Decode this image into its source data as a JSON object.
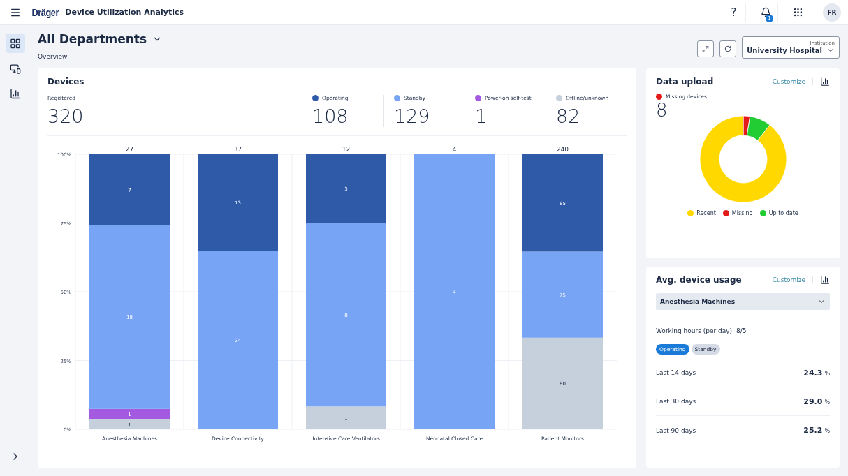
{
  "app": {
    "logo": "Dräger",
    "title": "Device Utilization Analytics"
  },
  "topbar": {
    "help": "?",
    "notification_count": "1",
    "avatar": "FR"
  },
  "sidebar": {
    "items": [
      {
        "kind": "grid",
        "selected": true
      },
      {
        "kind": "devices",
        "selected": false
      },
      {
        "kind": "chart",
        "selected": false
      }
    ]
  },
  "page": {
    "title": "All Departments",
    "subtitle": "Overview",
    "institution": {
      "label": "Institution",
      "value": "University Hospital"
    }
  },
  "devices": {
    "title": "Devices",
    "registered": {
      "label": "Registered",
      "value": "320"
    },
    "stats": [
      {
        "value": "108"
      },
      {
        "value": "129"
      },
      {
        "value": "1"
      },
      {
        "value": "82"
      }
    ],
    "chart_data": {
      "type": "bar",
      "stacked": true,
      "orientation": "vertical",
      "grid": true,
      "categories": [
        "Anesthesia Machines",
        "Device Connectivity",
        "Intensive Care Ventilators",
        "Neonatal Closed Care",
        "Patient Monitors"
      ],
      "series": [
        {
          "name": "Offline/unknown",
          "color": "#c6d0dc",
          "values": [
            3.7,
            0,
            8.3,
            0,
            33.3
          ]
        },
        {
          "name": "Power-on self-test",
          "color": "#a35ae0",
          "values": [
            3.7,
            0,
            0,
            0,
            0
          ]
        },
        {
          "name": "Standby",
          "color": "#78a4f5",
          "values": [
            66.7,
            64.9,
            66.7,
            100,
            31.3
          ]
        },
        {
          "name": "Operating",
          "color": "#2f5aa8",
          "values": [
            25.9,
            35.1,
            25,
            0,
            35.4
          ]
        }
      ],
      "ylim": [
        0,
        100
      ],
      "yticks": [
        {
          "value": 0,
          "label": "0%"
        },
        {
          "value": 25,
          "label": "25%"
        },
        {
          "value": 50,
          "label": "50%"
        },
        {
          "value": 75,
          "label": "75%"
        },
        {
          "value": 100,
          "label": "100%"
        }
      ],
      "annotations": [
        "27",
        "1",
        "1",
        "18",
        "7",
        "37",
        "24",
        "13",
        "12",
        "1",
        "8",
        "3",
        "4",
        "4",
        "240",
        "80",
        "75",
        "85"
      ]
    }
  },
  "data_upload": {
    "title": "Data upload",
    "customize": "Customize",
    "missing": {
      "label": "Missing devices",
      "value": "8",
      "color": "#e31a1a"
    },
    "legend": [
      {
        "label": "Recent",
        "color": "#ffd800"
      },
      {
        "label": "Missing",
        "color": "#e31a1a"
      },
      {
        "label": "Up to date",
        "color": "#22cc33"
      }
    ]
  },
  "usage": {
    "title": "Avg. device usage",
    "customize": "Customize",
    "device": "Anesthesia Machines",
    "working_hours": "Working hours (per day): 8/5",
    "filters": [
      {
        "label": "Operating",
        "selected": true
      },
      {
        "label": "Standby",
        "selected": false
      }
    ],
    "rows": [
      {
        "label": "Last 14 days",
        "value": "24.3",
        "unit": "%"
      },
      {
        "label": "Last 30 days",
        "value": "29.0",
        "unit": "%"
      },
      {
        "label": "Last 90 days",
        "value": "25.2",
        "unit": "%"
      }
    ]
  }
}
